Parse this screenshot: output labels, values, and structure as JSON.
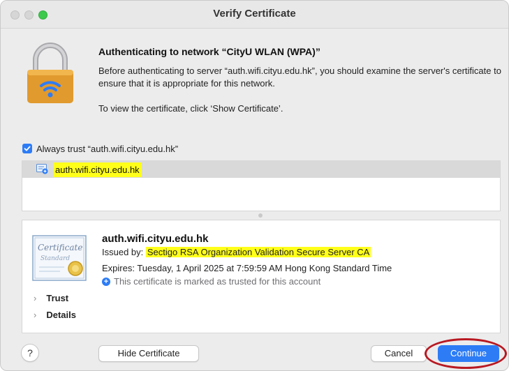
{
  "window": {
    "title": "Verify Certificate"
  },
  "header": {
    "heading": "Authenticating to network “CityU WLAN (WPA)”",
    "description": "Before authenticating to server “auth.wifi.cityu.edu.hk”, you should examine the server's certificate to ensure that it is appropriate for this network.",
    "hint": "To view the certificate, click ‘Show Certificate’."
  },
  "always_trust": {
    "label": "Always trust “auth.wifi.cityu.edu.hk”",
    "checked": true
  },
  "cert_list": {
    "items": [
      {
        "label": "auth.wifi.cityu.edu.hk",
        "selected": true,
        "highlighted": true
      }
    ]
  },
  "cert_detail": {
    "name": "auth.wifi.cityu.edu.hk",
    "issued_prefix": "Issued by:",
    "issued_by": "Sectigo RSA Organization Validation Secure Server CA",
    "expires": "Expires: Tuesday, 1 April 2025 at 7:59:59 AM Hong Kong Standard Time",
    "trusted_note": "This certificate is marked as trusted for this account",
    "image_lines": [
      "Certificate",
      "Standard"
    ],
    "disclosures": [
      {
        "label": "Trust"
      },
      {
        "label": "Details"
      }
    ]
  },
  "buttons": {
    "help": "?",
    "hide_certificate": "Hide Certificate",
    "cancel": "Cancel",
    "continue": "Continue"
  },
  "colors": {
    "accent": "#2d7cf6",
    "highlight": "#ffff1a",
    "annotation_circle": "#b81922",
    "lock_body": "#e09a2e",
    "zoom_button": "#3dc94b"
  }
}
